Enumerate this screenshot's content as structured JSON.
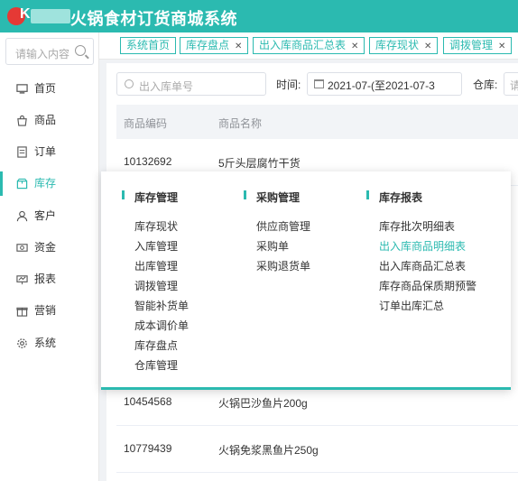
{
  "app": {
    "title": "火锅食材订货商城系统",
    "logo_letter": "K"
  },
  "sidebar": {
    "search_placeholder": "请输入内容",
    "items": [
      {
        "label": "首页",
        "icon": "monitor-icon"
      },
      {
        "label": "商品",
        "icon": "bag-icon"
      },
      {
        "label": "订单",
        "icon": "document-icon"
      },
      {
        "label": "库存",
        "icon": "box-icon",
        "active": true
      },
      {
        "label": "客户",
        "icon": "user-icon"
      },
      {
        "label": "资金",
        "icon": "money-icon"
      },
      {
        "label": "报表",
        "icon": "chart-icon"
      },
      {
        "label": "营销",
        "icon": "gift-icon"
      },
      {
        "label": "系统",
        "icon": "gear-icon"
      }
    ]
  },
  "tabs": [
    {
      "label": "系统首页",
      "closable": false
    },
    {
      "label": "库存盘点",
      "closable": true
    },
    {
      "label": "出入库商品汇总表",
      "closable": true
    },
    {
      "label": "库存现状",
      "closable": true
    },
    {
      "label": "调拨管理",
      "closable": true
    }
  ],
  "filters": {
    "order_placeholder": "出入库单号",
    "time_label": "时间:",
    "date_range": "2021-07-(至2021-07-3",
    "warehouse_label": "仓库:",
    "warehouse_placeholder": "请"
  },
  "table": {
    "headers": [
      "商品编码",
      "商品名称"
    ],
    "rows": [
      {
        "code": "10132692",
        "name": "5斤头层腐竹干货"
      },
      {
        "code": "10454568",
        "name": "火锅巴沙鱼片200g"
      },
      {
        "code": "10779439",
        "name": "火锅免浆黑鱼片250g"
      }
    ]
  },
  "menu": {
    "columns": [
      {
        "title": "库存管理",
        "links": [
          "库存现状",
          "入库管理",
          "出库管理",
          "调拨管理",
          "智能补货单",
          "成本调价单",
          "库存盘点",
          "仓库管理"
        ]
      },
      {
        "title": "采购管理",
        "links": [
          "供应商管理",
          "采购单",
          "采购退货单"
        ]
      },
      {
        "title": "库存报表",
        "links": [
          "库存批次明细表",
          "出入库商品明细表",
          "出入库商品汇总表",
          "库存商品保质期预警",
          "订单出库汇总"
        ],
        "highlighted_index": 1
      }
    ]
  },
  "colors": {
    "accent": "#2bbab0",
    "logo_red": "#e53935"
  }
}
